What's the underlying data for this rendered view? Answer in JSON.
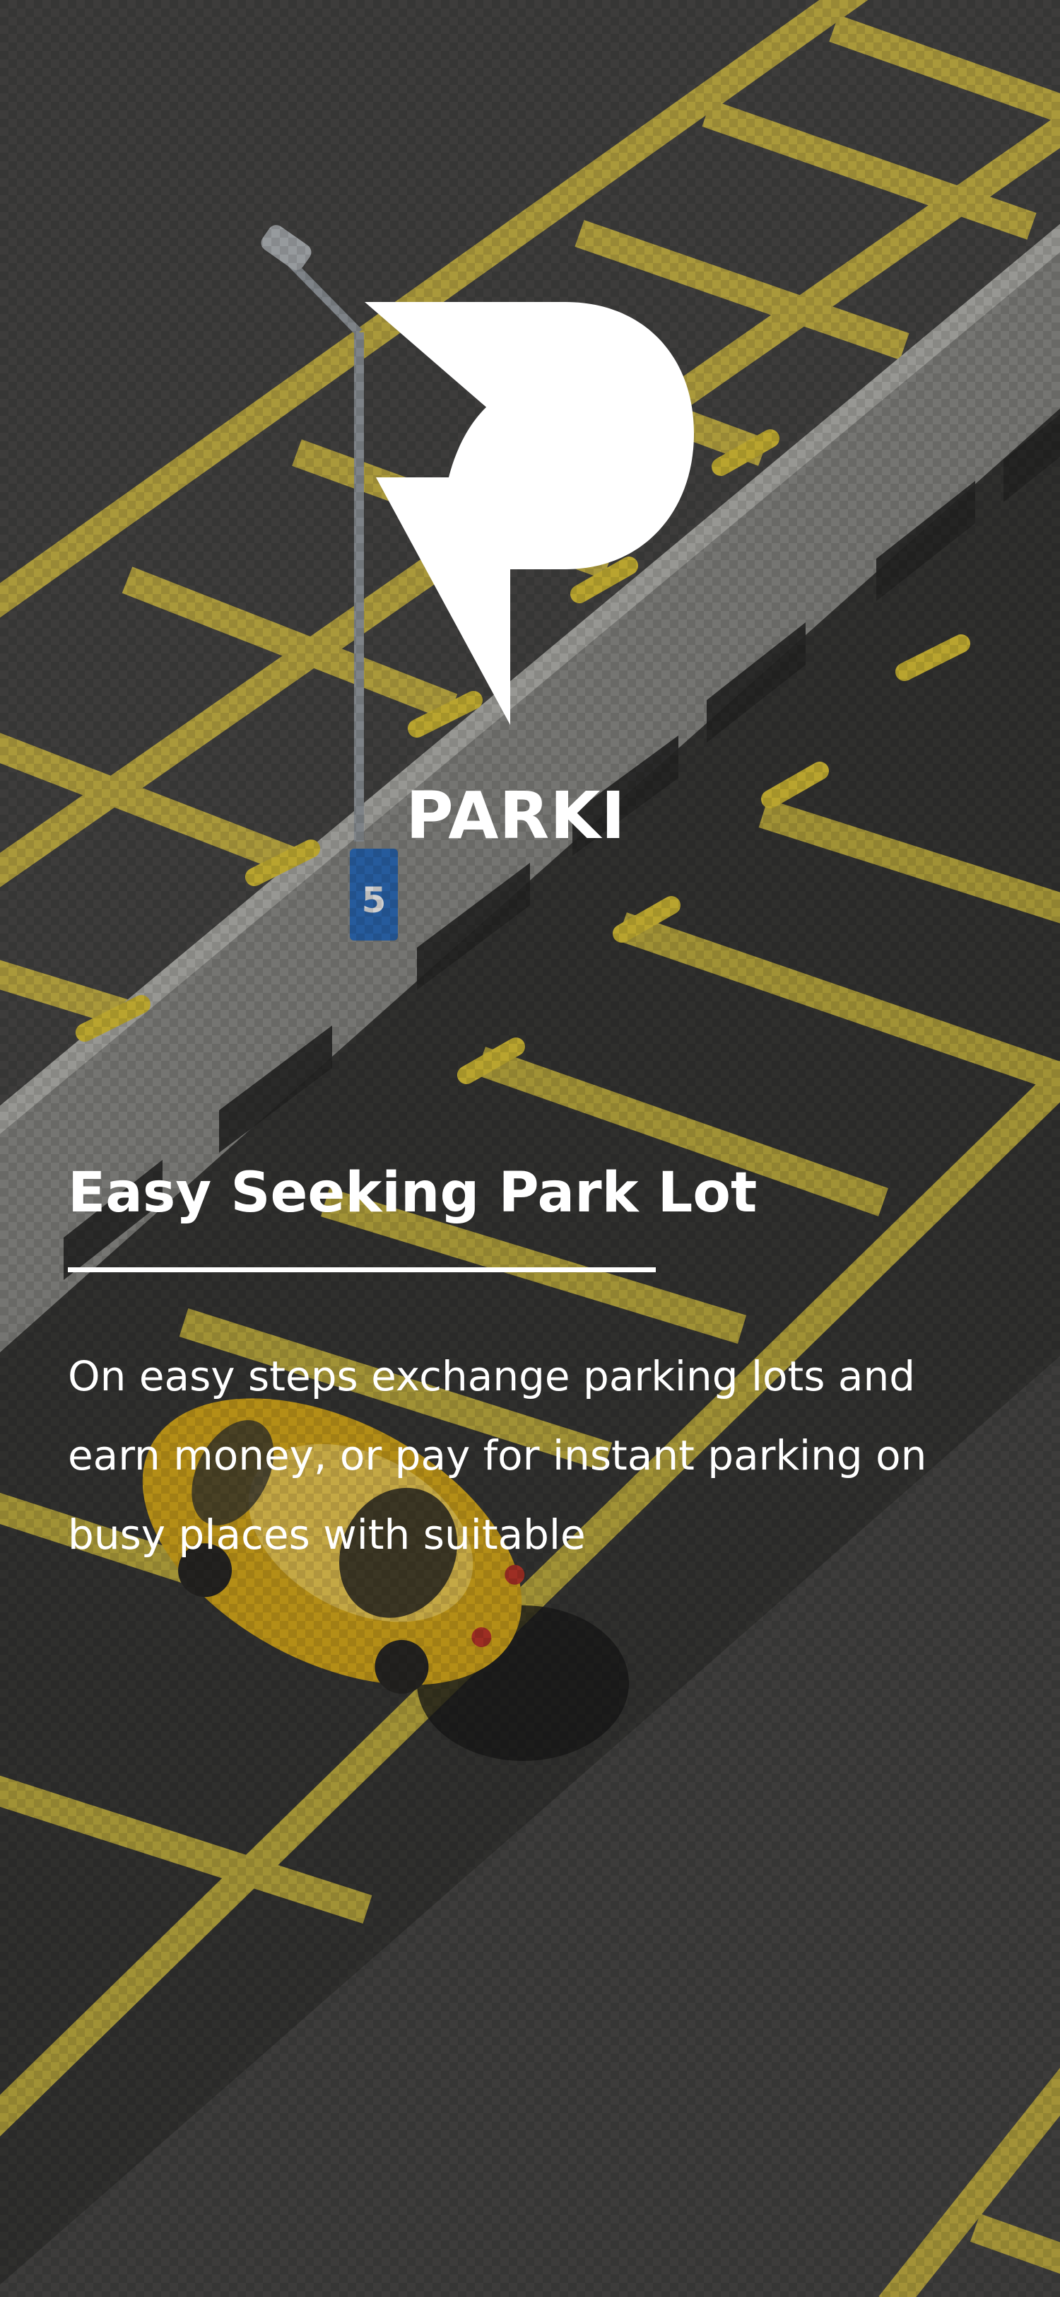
{
  "brand": {
    "name": "PARKI"
  },
  "onboarding": {
    "headline": "Easy Seeking Park Lot",
    "description": "On easy steps exchange parking lots and earn money, or pay for instant parking on busy places with suitable"
  },
  "background": {
    "icon": "parking-lot-photo"
  },
  "colors": {
    "text": "#ffffff",
    "line_yellow": "#e6cf3c",
    "car_yellow": "#e8b820",
    "asphalt": "#4a4947"
  }
}
